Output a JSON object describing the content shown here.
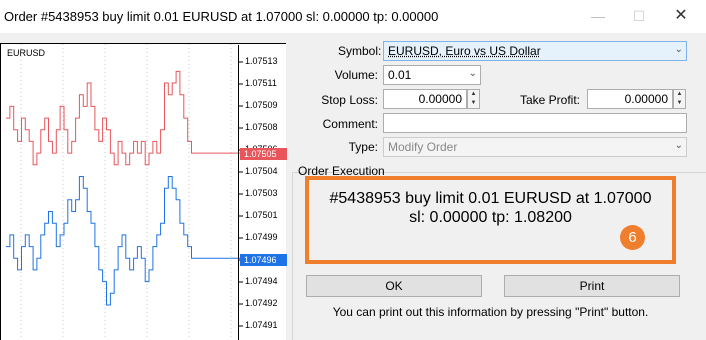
{
  "window": {
    "title": "Order #5438953 buy limit 0.01 EURUSD at 1.07000 sl: 0.00000 tp: 0.00000",
    "minimize_glyph": "—",
    "maximize_glyph": "☐",
    "close_glyph": "✕"
  },
  "chart": {
    "symbol": "EURUSD",
    "price_ticks": [
      "1.07513",
      "1.07511",
      "1.07509",
      "1.07508",
      "1.07506",
      "1.07504",
      "1.07503",
      "1.07501",
      "1.07499",
      "1.07497",
      "1.07494",
      "1.07492",
      "1.07491",
      "1.07489"
    ],
    "bid_tag": "1.07505",
    "ask_tag": "1.07496",
    "bid_color": "#e8565b",
    "ask_color": "#1e73e8"
  },
  "chart_data": {
    "type": "line",
    "series": [
      {
        "values": [
          1.07508,
          1.07509,
          1.07507,
          1.07506,
          1.07508,
          1.07507,
          1.07506,
          1.07504,
          1.07505,
          1.07507,
          1.07508,
          1.07506,
          1.07505,
          1.07507,
          1.07509,
          1.07507,
          1.07505,
          1.07506,
          1.07508,
          1.0751,
          1.07509,
          1.07511,
          1.07509,
          1.07507,
          1.07506,
          1.07508,
          1.07507,
          1.07505,
          1.07504,
          1.07506,
          1.07505,
          1.07504,
          1.07505,
          1.07506,
          1.07505,
          1.07506,
          1.07504,
          1.07505,
          1.07506,
          1.07505,
          1.07507,
          1.07511,
          1.0751,
          1.07511,
          1.07512,
          1.0751,
          1.07508,
          1.07506,
          1.07505,
          1.07505,
          1.07505,
          1.07505,
          1.07505
        ]
      },
      {
        "values": [
          1.07497,
          1.07498,
          1.07496,
          1.07495,
          1.07497,
          1.07498,
          1.07497,
          1.07495,
          1.07496,
          1.07498,
          1.07499,
          1.075,
          1.07499,
          1.07497,
          1.07498,
          1.07499,
          1.07501,
          1.075,
          1.07501,
          1.07503,
          1.07502,
          1.075,
          1.07499,
          1.07497,
          1.07495,
          1.07494,
          1.07492,
          1.07493,
          1.07495,
          1.07497,
          1.07498,
          1.07496,
          1.07495,
          1.07496,
          1.07497,
          1.07496,
          1.07494,
          1.07495,
          1.07497,
          1.07498,
          1.07499,
          1.07502,
          1.07503,
          1.07502,
          1.07501,
          1.07499,
          1.07498,
          1.07497,
          1.07496,
          1.07496,
          1.07496,
          1.07496,
          1.07496
        ]
      }
    ],
    "ylim": [
      1.07489,
      1.07514
    ]
  },
  "form": {
    "symbol_label": "Symbol:",
    "symbol_value": "EURUSD, Euro vs US Dollar",
    "volume_label": "Volume:",
    "volume_value": "0.01",
    "stop_loss_label": "Stop Loss:",
    "stop_loss_value": "0.00000",
    "take_profit_label": "Take Profit:",
    "take_profit_value": "0.00000",
    "comment_label": "Comment:",
    "comment_value": "",
    "type_label": "Type:",
    "type_value": "Modify Order"
  },
  "execution": {
    "group_label": "Order Execution",
    "line1": "#5438953 buy limit 0.01 EURUSD at 1.07000",
    "line2": "sl: 0.00000 tp: 1.08200",
    "badge": "6",
    "highlight_color": "#f07f2d",
    "ok_label": "OK",
    "print_label": "Print",
    "note": "You can print out this information by pressing \"Print\" button."
  }
}
